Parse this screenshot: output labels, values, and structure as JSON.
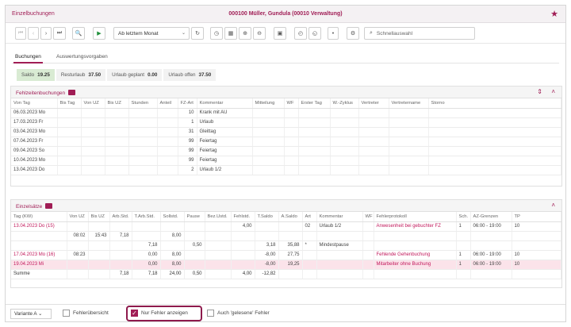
{
  "window": {
    "app_name": "Einzelbuchungen",
    "title": "000100  Müller, Gundula  (00010 Verwaltung)"
  },
  "toolbar": {
    "period_select": "Ab letztem Monat",
    "search_placeholder": "Schnellauswahl"
  },
  "tabs": [
    {
      "label": "Buchungen",
      "active": true
    },
    {
      "label": "Auswertungsvorgaben",
      "active": false
    }
  ],
  "summary": [
    {
      "label": "Saldo",
      "value": "19.25"
    },
    {
      "label": "Resturlaub",
      "value": "37.50"
    },
    {
      "label": "Urlaub geplant",
      "value": "0.00"
    },
    {
      "label": "Urlaub offen",
      "value": "37.50"
    }
  ],
  "absences": {
    "title": "Fehlzeitenbuchungen",
    "columns": [
      "Von Tag",
      "Bis Tag",
      "Von UZ",
      "Bis UZ",
      "Stunden",
      "Anteil",
      "FZ-Art",
      "Kommentar",
      "Mitteilung",
      "WF",
      "Erster Tag",
      "W.-Zyklus",
      "Vertreter",
      "Vertretername",
      "Storno"
    ],
    "rows": [
      [
        "06.03.2023 Mo",
        "",
        "",
        "",
        "",
        "",
        "10",
        "Krank mit AU",
        "",
        "",
        "",
        "",
        "",
        "",
        ""
      ],
      [
        "17.03.2023 Fr",
        "",
        "",
        "",
        "",
        "",
        "1",
        "Urlaub",
        "",
        "",
        "",
        "",
        "",
        "",
        ""
      ],
      [
        "03.04.2023 Mo",
        "",
        "",
        "",
        "",
        "",
        "31",
        "Gleittag",
        "",
        "",
        "",
        "",
        "",
        "",
        ""
      ],
      [
        "07.04.2023 Fr",
        "",
        "",
        "",
        "",
        "",
        "99",
        "Feiertag",
        "",
        "",
        "",
        "",
        "",
        "",
        ""
      ],
      [
        "09.04.2023 So",
        "",
        "",
        "",
        "",
        "",
        "99",
        "Feiertag",
        "",
        "",
        "",
        "",
        "",
        "",
        ""
      ],
      [
        "10.04.2023 Mo",
        "",
        "",
        "",
        "",
        "",
        "99",
        "Feiertag",
        "",
        "",
        "",
        "",
        "",
        "",
        ""
      ],
      [
        "13.04.2023 Do",
        "",
        "",
        "",
        "",
        "",
        "2",
        "Urlaub 1/2",
        "",
        "",
        "",
        "",
        "",
        "",
        ""
      ]
    ]
  },
  "records": {
    "title": "Einzelsätze",
    "columns": [
      "Tag (KW)",
      "Von UZ",
      "Bis UZ",
      "Arb.Std.",
      "T.Arb.Std.",
      "Sollstd.",
      "Pause",
      "Bez.Ustd.",
      "Fehlstd.",
      "T.Saldo",
      "A.Saldo",
      "Art",
      "Kommentar",
      "WF",
      "Fehlerprotokoll",
      "Sch.",
      "AZ-Grenzen",
      "TP"
    ],
    "rows": [
      {
        "type": "err",
        "cells": [
          "13.04.2023 Do (15)",
          "",
          "",
          "",
          "",
          "",
          "",
          "",
          "4,00",
          "",
          "",
          "02",
          "Urlaub 1/2",
          "",
          "Anwesenheit bei gebuchter FZ",
          "1",
          "06:00 - 19:00",
          "10"
        ]
      },
      {
        "type": "",
        "cells": [
          "",
          "08:02",
          "15:43",
          "7,18",
          "",
          "8,00",
          "",
          "",
          "",
          "",
          "",
          "",
          "",
          "",
          "",
          "",
          "",
          ""
        ]
      },
      {
        "type": "",
        "cells": [
          "",
          "",
          "",
          "",
          "7,18",
          "",
          "0,50",
          "",
          "",
          "3,18",
          "35,88",
          "*",
          "Mindestpause",
          "",
          "",
          "",
          "",
          ""
        ]
      },
      {
        "type": "err",
        "cells": [
          "17.04.2023 Mo (16)",
          "08:23",
          "",
          "",
          "0,00",
          "8,00",
          "",
          "",
          "",
          "-8,00",
          "27,75",
          "",
          "",
          "",
          "Fehlende Gehenbuchung",
          "1",
          "06:00 - 19:00",
          "10"
        ]
      },
      {
        "type": "err pink",
        "cells": [
          "19.04.2023 Mi",
          "",
          "",
          "",
          "0,00",
          "8,00",
          "",
          "",
          "",
          "-8,00",
          "19,25",
          "",
          "",
          "",
          "Mitarbeiter ohne Buchung",
          "1",
          "06:00 - 19:00",
          "10"
        ]
      },
      {
        "type": "sum",
        "cells": [
          "Summe",
          "",
          "",
          "7,18",
          "7,18",
          "24,00",
          "0,50",
          "",
          "4,00",
          "-12,82",
          "",
          "",
          "",
          "",
          "",
          "",
          "",
          ""
        ]
      }
    ]
  },
  "bottom": {
    "variant": "Variante A",
    "cb_errors_overview": "Fehlerübersicht",
    "cb_only_errors": "Nur Fehler anzeigen",
    "cb_read_errors": "Auch 'gelesene' Fehler"
  },
  "colors": {
    "accent": "#a01d55",
    "error_text": "#c2185b",
    "error_row_bg": "#fbe3ea",
    "saldo_bg": "#d9ebd3"
  }
}
